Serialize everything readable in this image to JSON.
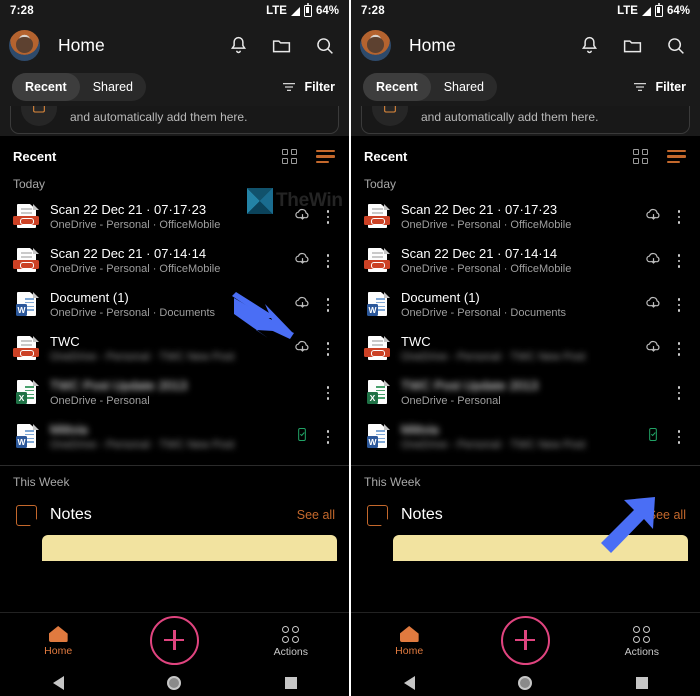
{
  "status_bar": {
    "time": "7:28",
    "network": "LTE",
    "battery": "64%"
  },
  "app_bar": {
    "title": "Home",
    "icons": [
      "bell-icon",
      "folder-icon",
      "search-icon"
    ]
  },
  "tabs": {
    "recent": "Recent",
    "shared": "Shared",
    "filter": "Filter"
  },
  "promo": {
    "text": "and automatically add them here."
  },
  "section": {
    "title": "Recent",
    "group_today": "Today",
    "group_week": "This Week"
  },
  "files": [
    {
      "title": "Scan 22 Dec 21 · 07·17·23",
      "sub": "OneDrive - Personal · OfficeMobile",
      "kind": "pdf",
      "action": "cloud-download-icon",
      "blurred": false
    },
    {
      "title": "Scan 22 Dec 21 · 07·14·14",
      "sub": "OneDrive - Personal · OfficeMobile",
      "kind": "pdf",
      "action": "cloud-download-icon",
      "blurred": false
    },
    {
      "title": "Document (1)",
      "sub": "OneDrive - Personal · Documents",
      "kind": "word",
      "action": "cloud-download-icon",
      "blurred": false
    },
    {
      "title": "TWC",
      "sub": "OneDrive - Personal · TWC New Post",
      "kind": "pdf",
      "action": "cloud-download-icon",
      "blurred": "sub"
    },
    {
      "title": "TWC Post Update 2013",
      "sub": "OneDrive - Personal",
      "kind": "excel",
      "action": "none",
      "blurred": "title"
    },
    {
      "title": "Mittvia",
      "sub": "OneDrive - Personal · TWC New Post",
      "kind": "word",
      "action": "offline-available-icon",
      "blurred": "both"
    }
  ],
  "notes": {
    "title": "Notes",
    "see_all": "See all",
    "note_icon": "sticky-note-icon"
  },
  "bottom_nav": {
    "home": "Home",
    "actions": "Actions",
    "fab": "create-plus-button"
  },
  "android_nav": {
    "back": "back-icon",
    "home": "home-icon",
    "recents": "recents-icon"
  },
  "watermark": {
    "text": "TheWin"
  },
  "colors": {
    "accent": "#c4682c",
    "fab": "#e0447f",
    "offline": "#21a366",
    "arrow": "#4a6ef5",
    "note_card": "#f2e3a0"
  }
}
